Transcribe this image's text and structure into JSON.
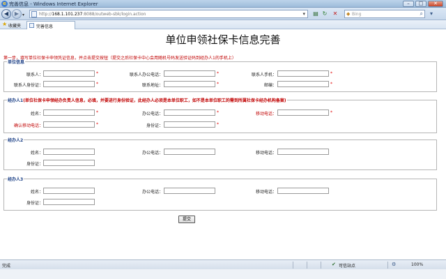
{
  "window": {
    "title": "完善信息 - Windows Internet Explorer",
    "buttons": {
      "minimize": "–",
      "maximize": "□",
      "close": "✕"
    }
  },
  "address_bar": {
    "url_prefix": "http://",
    "url_host": "168.1.101.237",
    "url_rest": ":8088/outweb-sbk/login.action"
  },
  "search": {
    "placeholder": "Bing"
  },
  "favorites": {
    "label": "收藏夹"
  },
  "tab": {
    "label": "完善信息"
  },
  "page": {
    "title": "单位申领社保卡信息完善",
    "step_text": "第一步，填写单位社保卡申领凭证信息，并点击提交按钮（提交之后社保卡中心会用随机号码发送验证码到经办人1的手机上）",
    "required_mark": "*",
    "submit_label": "提交"
  },
  "sections": {
    "unit": {
      "legend": "单位信息",
      "contact_name": "联系人：",
      "contact_office_phone": "联系人办公电话：",
      "contact_mobile": "联系人手机：",
      "contact_id": "联系人身份证：",
      "contact_address": "联系地址：",
      "postcode": "邮编："
    },
    "agent1": {
      "legend": "经办人1",
      "note": "(单位社保卡申领经办负责人信息，必填，并要进行身份验证，此经办人必须是本单位职工，如不是本单位职工的需到所属社保卡经办机构备案)",
      "name": "姓名：",
      "office_phone": "办公电话：",
      "mobile": "移动电话：",
      "confirm_mobile": "确认移动电话：",
      "id": "身份证："
    },
    "agent2": {
      "legend": "经办人2",
      "name": "姓名：",
      "office_phone": "办公电话：",
      "mobile": "移动电话：",
      "id": "身份证："
    },
    "agent3": {
      "legend": "经办人3",
      "name": "姓名：",
      "office_phone": "办公电话：",
      "mobile": "移动电话：",
      "id": "身份证："
    }
  },
  "status_bar": {
    "left_text": "完成",
    "zone_text": "可信站点",
    "zoom_text": "100%"
  },
  "colors": {
    "required": "#e00000",
    "note_red": "#c00000",
    "legend_blue": "#1b3f86"
  }
}
